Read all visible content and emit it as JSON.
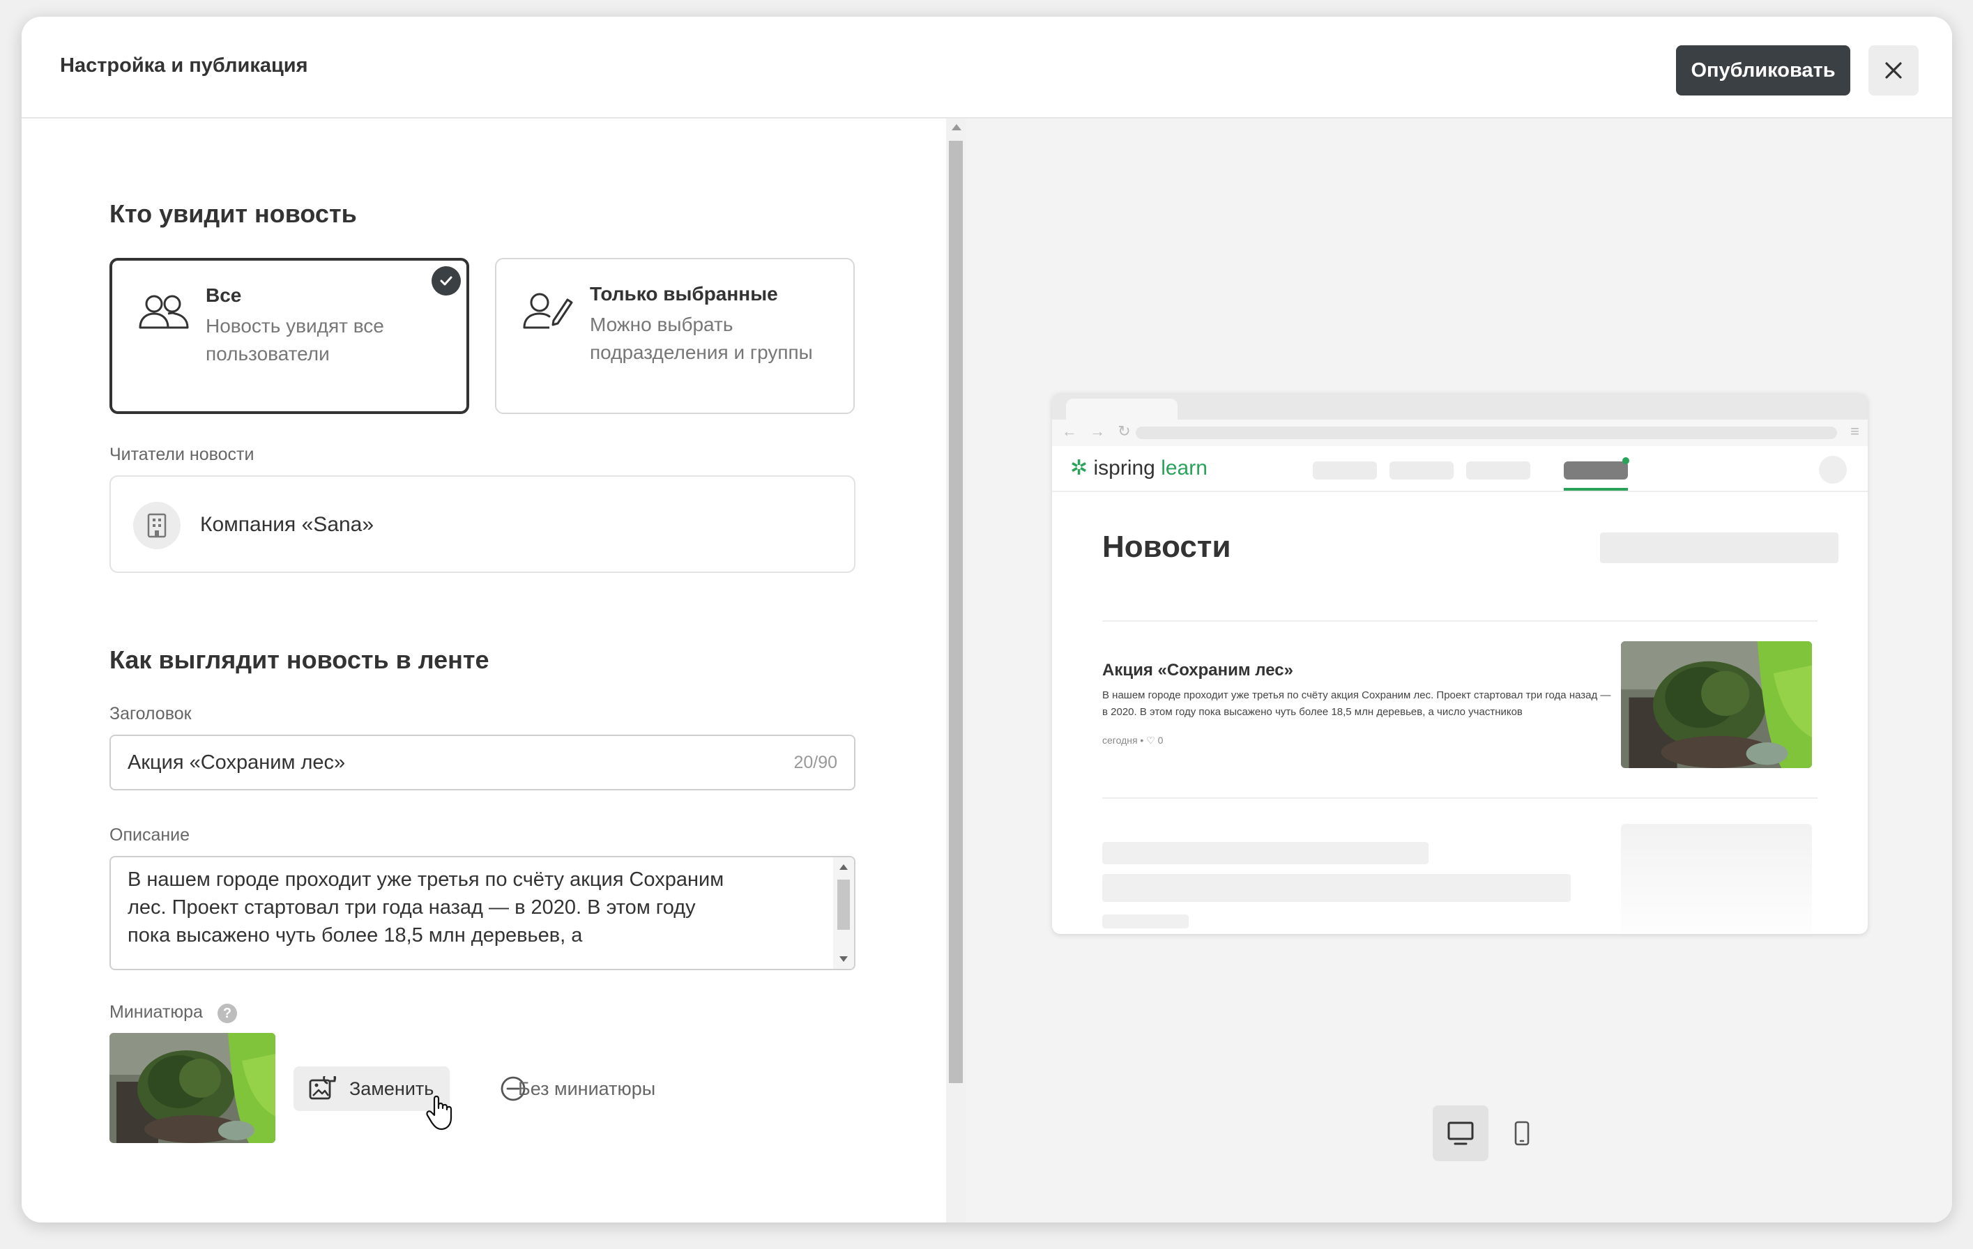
{
  "header": {
    "title": "Настройка и публикация",
    "publish_label": "Опубликовать"
  },
  "audience": {
    "heading": "Кто увидит новость",
    "options": [
      {
        "title": "Все",
        "desc": "Новость увидят все пользователи",
        "selected": true,
        "icon": "users-icon"
      },
      {
        "title": "Только выбранные",
        "desc": "Можно выбрать подразделения и группы",
        "selected": false,
        "icon": "user-edit-icon"
      }
    ],
    "readers_label": "Читатели новости",
    "readers_company": "Компания «Sana»"
  },
  "appearance": {
    "heading": "Как выглядит новость в ленте",
    "title_label": "Заголовок",
    "title_value": "Акция «Сохраним лес»",
    "title_counter": "20/90",
    "desc_label": "Описание",
    "desc_value": "В нашем городе проходит уже третья по счёту акция Сохраним лес. Проект стартовал три года назад — в 2020. В этом году пока высажено чуть более 18,5 млн деревьев, а",
    "thumb_label": "Миниатюра",
    "help_glyph": "?",
    "replace_label": "Заменить",
    "no_thumb_label": "Без миниатюры"
  },
  "preview": {
    "nav_glyphs": "← → ↻",
    "menu_glyph": "≡",
    "logo_main": "ispring",
    "logo_accent": "learn",
    "logo_mark": "✲",
    "page_title": "Новости",
    "card_title": "Акция «Сохраним лес»",
    "card_desc": "В нашем городе проходит уже третья по счёту акция Сохраним лес. Проект стартовал три года назад — в 2020. В этом году пока высажено чуть более 18,5 млн деревьев, а число участников",
    "card_meta": "сегодня  •  ♡ 0"
  },
  "colors": {
    "accent_green": "#29a35a",
    "dark_button": "#3b4044"
  }
}
